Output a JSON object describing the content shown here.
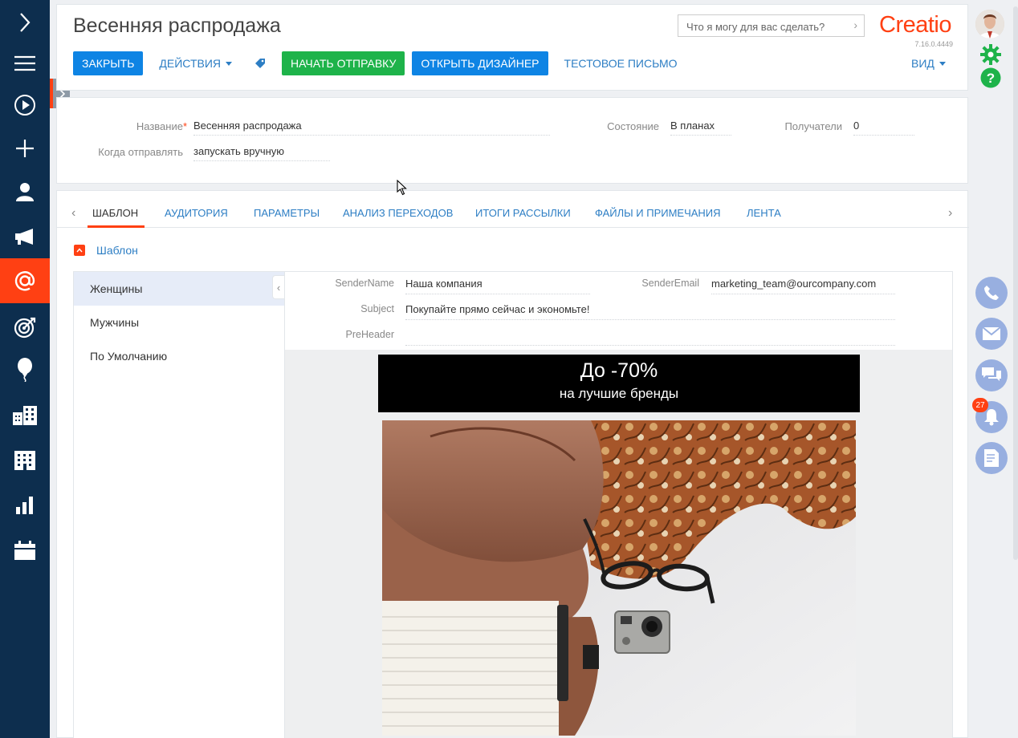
{
  "app": {
    "logo": "Creatio",
    "version": "7.16.0.4449"
  },
  "header": {
    "title": "Весенняя распродажа",
    "search_placeholder": "Что я могу для вас сделать?",
    "close_label": "ЗАКРЫТЬ",
    "actions_label": "ДЕЙСТВИЯ",
    "start_label": "НАЧАТЬ ОТПРАВКУ",
    "designer_label": "ОТКРЫТЬ ДИЗАЙНЕР",
    "test_label": "ТЕСТОВОЕ ПИСЬМО",
    "view_label": "ВИД"
  },
  "details": {
    "name_label": "Название",
    "name_value": "Весенняя распродажа",
    "when_label": "Когда отправлять",
    "when_value": "запускать вручную",
    "state_label": "Состояние",
    "state_value": "В планах",
    "recipients_label": "Получатели",
    "recipients_value": "0"
  },
  "tabs": [
    {
      "label": "ШАБЛОН"
    },
    {
      "label": "АУДИТОРИЯ"
    },
    {
      "label": "ПАРАМЕТРЫ"
    },
    {
      "label": "АНАЛИЗ ПЕРЕХОДОВ"
    },
    {
      "label": "ИТОГИ РАССЫЛКИ"
    },
    {
      "label": "ФАЙЛЫ И ПРИМЕЧАНИЯ"
    },
    {
      "label": "ЛЕНТА"
    }
  ],
  "template": {
    "section_title": "Шаблон",
    "variants": [
      {
        "label": "Женщины"
      },
      {
        "label": "Мужчины"
      },
      {
        "label": "По Умолчанию"
      }
    ],
    "sender_name_label": "SenderName",
    "sender_name_value": "Наша компания",
    "sender_email_label": "SenderEmail",
    "sender_email_value": "marketing_team@ourcompany.com",
    "subject_label": "Subject",
    "subject_value": "Покупайте прямо сейчас и экономьте!",
    "preheader_label": "PreHeader",
    "preheader_value": "",
    "banner_main": "До -70%",
    "banner_sub": "на лучшие бренды"
  },
  "notifications": {
    "count": "27"
  },
  "colors": {
    "accent": "#ff4013",
    "nav": "#0d2e4e",
    "blue": "#0e84e4",
    "green": "#1eb34a"
  }
}
